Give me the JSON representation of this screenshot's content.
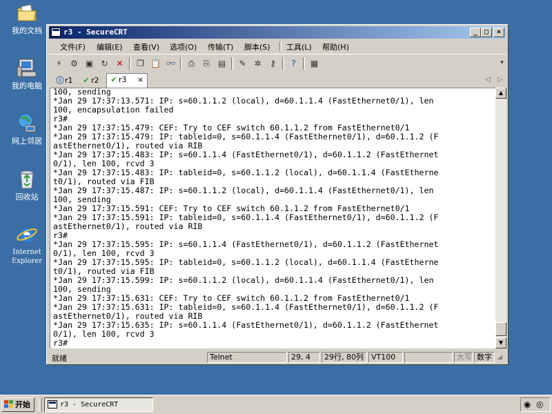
{
  "desktop": {
    "icons": [
      {
        "label": "我的文档",
        "icon": "folder-documents-icon"
      },
      {
        "label": "我的电脑",
        "icon": "computer-icon"
      },
      {
        "label": "网上邻居",
        "icon": "network-icon"
      },
      {
        "label": "回收站",
        "icon": "recycle-bin-icon"
      },
      {
        "label_line1": "Internet",
        "label_line2": "Explorer",
        "icon": "internet-explorer-icon"
      }
    ]
  },
  "window": {
    "title": "r3 - SecureCRT",
    "controls": {
      "minimize": "_",
      "maximize": "□",
      "close": "×"
    }
  },
  "menu": {
    "items": [
      "文件(F)",
      "编辑(E)",
      "查看(V)",
      "选项(O)",
      "传输(T)",
      "脚本(S)",
      "工具(L)",
      "帮助(H)"
    ]
  },
  "tabs": [
    {
      "label": "r1",
      "status": "info"
    },
    {
      "label": "r2",
      "status": "connected"
    },
    {
      "label": "r3",
      "status": "connected",
      "active": true,
      "close": "×"
    }
  ],
  "terminal": {
    "lines": [
      "100, sending",
      "*Jan 29 17:37:13.571: IP: s=60.1.1.2 (local), d=60.1.1.4 (FastEthernet0/1), len",
      "100, encapsulation failed",
      "r3#",
      "*Jan 29 17:37:15.479: CEF: Try to CEF switch 60.1.1.2 from FastEthernet0/1",
      "*Jan 29 17:37:15.479: IP: tableid=0, s=60.1.1.4 (FastEthernet0/1), d=60.1.1.2 (F",
      "astEthernet0/1), routed via RIB",
      "*Jan 29 17:37:15.483: IP: s=60.1.1.4 (FastEthernet0/1), d=60.1.1.2 (FastEthernet",
      "0/1), len 100, rcvd 3",
      "*Jan 29 17:37:15.483: IP: tableid=0, s=60.1.1.2 (local), d=60.1.1.4 (FastEtherne",
      "t0/1), routed via FIB",
      "*Jan 29 17:37:15.487: IP: s=60.1.1.2 (local), d=60.1.1.4 (FastEthernet0/1), len",
      "100, sending",
      "*Jan 29 17:37:15.591: CEF: Try to CEF switch 60.1.1.2 from FastEthernet0/1",
      "*Jan 29 17:37:15.591: IP: tableid=0, s=60.1.1.4 (FastEthernet0/1), d=60.1.1.2 (F",
      "astEthernet0/1), routed via RIB",
      "r3#",
      "*Jan 29 17:37:15.595: IP: s=60.1.1.4 (FastEthernet0/1), d=60.1.1.2 (FastEthernet",
      "0/1), len 100, rcvd 3",
      "*Jan 29 17:37:15.595: IP: tableid=0, s=60.1.1.2 (local), d=60.1.1.4 (FastEtherne",
      "t0/1), routed via FIB",
      "*Jan 29 17:37:15.599: IP: s=60.1.1.2 (local), d=60.1.1.4 (FastEthernet0/1), len",
      "100, sending",
      "*Jan 29 17:37:15.631: CEF: Try to CEF switch 60.1.1.2 from FastEthernet0/1",
      "*Jan 29 17:37:15.631: IP: tableid=0, s=60.1.1.4 (FastEthernet0/1), d=60.1.1.2 (F",
      "astEthernet0/1), routed via RIB",
      "*Jan 29 17:37:15.635: IP: s=60.1.1.4 (FastEthernet0/1), d=60.1.1.2 (FastEthernet",
      "0/1), len 100, rcvd 3",
      "r3#"
    ]
  },
  "statusbar": {
    "ready": "就绪",
    "protocol": "Telnet",
    "cursor": "29,  4",
    "size": "29行, 80列",
    "emulation": "VT100",
    "blank": "",
    "caps": "大写",
    "num": "数字"
  },
  "taskbar": {
    "start_label": "开始",
    "task_label": "r3 - SecureCRT"
  },
  "colors": {
    "desktop": "#3a6ea5",
    "title_start": "#0a246a",
    "title_end": "#a6caf0",
    "chrome": "#d4d0c8",
    "tab_check": "#2e9a2e"
  }
}
